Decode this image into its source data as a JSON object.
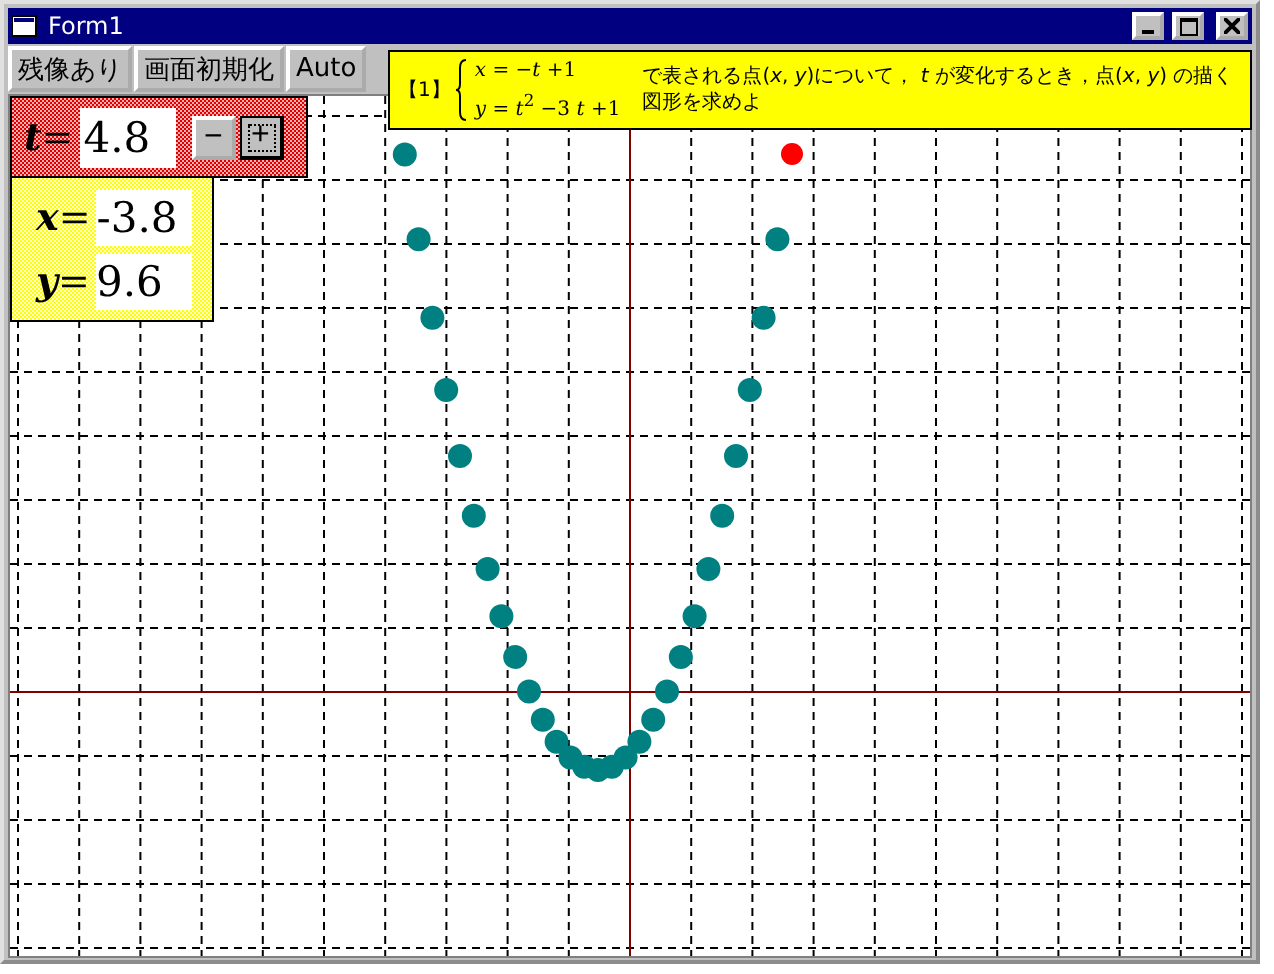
{
  "window": {
    "title": "Form1"
  },
  "toolbar": {
    "buttons": [
      "残像あり",
      "画面初期化",
      "Auto"
    ]
  },
  "parameter_panel": {
    "label": "**t**=",
    "value": "4.8",
    "buttons": [
      {
        "label": "−",
        "focused": false
      },
      {
        "label": "+",
        "focused": true
      }
    ]
  },
  "coordinates": [
    {
      "label": "**x**=",
      "value": "-3.8"
    },
    {
      "label": "**y**=",
      "value": "9.6"
    }
  ],
  "problem": {
    "number": "【1】",
    "equations": [
      "*x* = −*t* +1",
      "*y* = *t*$^{2}$ −3 *t* +1"
    ],
    "text": "で表される点(*x*, *y*)について， *t* が変化するとき，点(*x*, *y*) の描く図形を求めよ"
  }
}
